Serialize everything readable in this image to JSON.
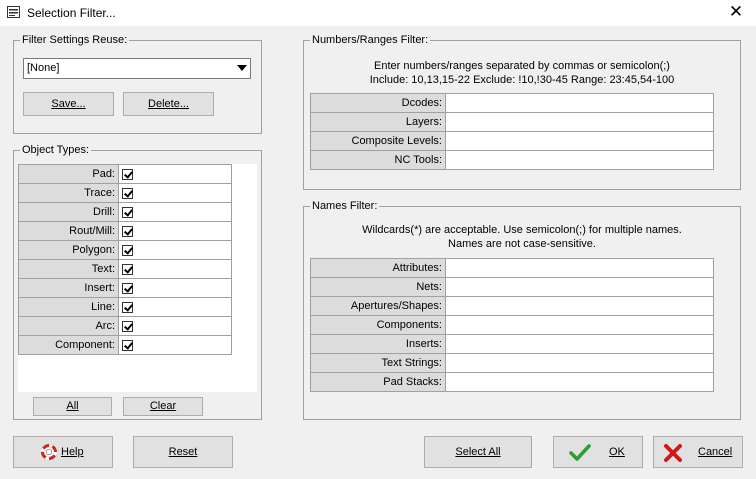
{
  "window": {
    "title": "Selection Filter...",
    "close_glyph": "✕"
  },
  "filter_reuse": {
    "legend": "Filter Settings Reuse:",
    "selected": "[None]",
    "save_label": "Save...",
    "delete_label": "Delete..."
  },
  "object_types": {
    "legend": "Object Types:",
    "items": [
      {
        "label": "Pad:",
        "checked": true
      },
      {
        "label": "Trace:",
        "checked": true
      },
      {
        "label": "Drill:",
        "checked": true
      },
      {
        "label": "Rout/Mill:",
        "checked": true
      },
      {
        "label": "Polygon:",
        "checked": true
      },
      {
        "label": "Text:",
        "checked": true
      },
      {
        "label": "Insert:",
        "checked": true
      },
      {
        "label": "Line:",
        "checked": true
      },
      {
        "label": "Arc:",
        "checked": true
      },
      {
        "label": "Component:",
        "checked": true
      }
    ],
    "all_label": "All",
    "clear_label": "Clear"
  },
  "numbers_filter": {
    "legend": "Numbers/Ranges Filter:",
    "hint1": "Enter numbers/ranges separated by commas or semicolon(;)",
    "hint2": "Include: 10,13,15-22   Exclude: !10,!30-45   Range: 23:45,54-100",
    "rows": [
      {
        "label": "Dcodes:",
        "value": ""
      },
      {
        "label": "Layers:",
        "value": ""
      },
      {
        "label": "Composite Levels:",
        "value": ""
      },
      {
        "label": "NC Tools:",
        "value": ""
      }
    ]
  },
  "names_filter": {
    "legend": "Names Filter:",
    "hint1": "Wildcards(*) are acceptable.  Use semicolon(;) for multiple names.",
    "hint2": "Names are not case-sensitive.",
    "rows": [
      {
        "label": "Attributes:",
        "value": ""
      },
      {
        "label": "Nets:",
        "value": ""
      },
      {
        "label": "Apertures/Shapes:",
        "value": ""
      },
      {
        "label": "Components:",
        "value": ""
      },
      {
        "label": "Inserts:",
        "value": ""
      },
      {
        "label": "Text Strings:",
        "value": ""
      },
      {
        "label": "Pad Stacks:",
        "value": ""
      }
    ]
  },
  "footer": {
    "help_label": "Help",
    "reset_label": "Reset",
    "select_all_label": "Select All",
    "ok_label": "OK",
    "cancel_label": "Cancel"
  },
  "icons": {
    "help": "lifebuoy-icon",
    "ok": "checkmark-icon",
    "cancel": "red-x-icon",
    "dropdown": "chevron-down-icon"
  },
  "colors": {
    "ok_green": "#2e9e2e",
    "cancel_red": "#d01818"
  }
}
